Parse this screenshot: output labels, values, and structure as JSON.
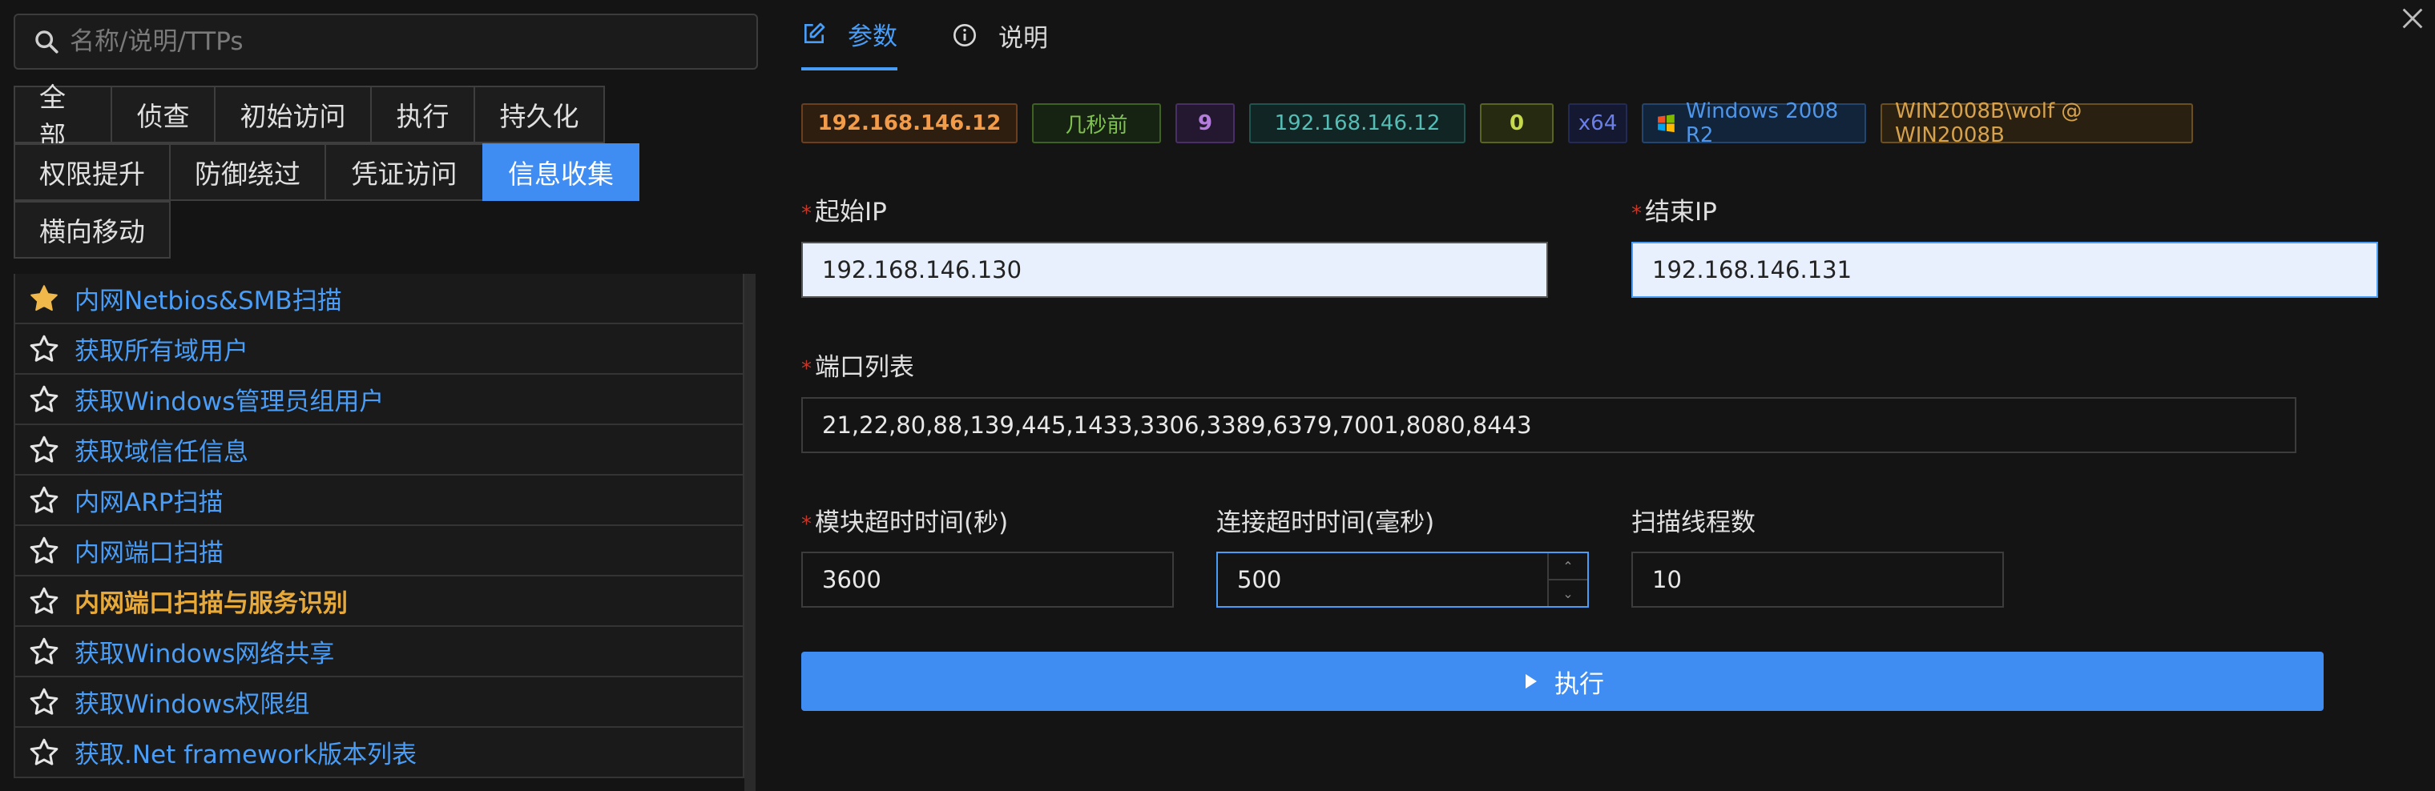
{
  "search": {
    "placeholder": "名称/说明/TTPs",
    "icon": "search-icon"
  },
  "categories": {
    "row1": [
      "全部",
      "侦查",
      "初始访问",
      "执行",
      "持久化"
    ],
    "row2": [
      "权限提升",
      "防御绕过",
      "凭证访问",
      "信息收集"
    ],
    "row3": [
      "横向移动"
    ],
    "active": "信息收集"
  },
  "modules": [
    {
      "label": "内网Netbios&SMB扫描",
      "favorite": true
    },
    {
      "label": "获取所有域用户",
      "favorite": false
    },
    {
      "label": "获取Windows管理员组用户",
      "favorite": false
    },
    {
      "label": "获取域信任信息",
      "favorite": false
    },
    {
      "label": "内网ARP扫描",
      "favorite": false
    },
    {
      "label": "内网端口扫描",
      "favorite": false
    },
    {
      "label": "内网端口扫描与服务识别",
      "favorite": false,
      "selected": true
    },
    {
      "label": "获取Windows网络共享",
      "favorite": false
    },
    {
      "label": "获取Windows权限组",
      "favorite": false
    },
    {
      "label": "获取.Net framework版本列表",
      "favorite": false
    }
  ],
  "tabs": {
    "params": "参数",
    "description": "说明"
  },
  "session": {
    "ip": "192.168.146.12",
    "last_seen": "几秒前",
    "pid": "9",
    "internal_ip": "192.168.146.12",
    "zero": "0",
    "arch": "x64",
    "os": "Windows 2008 R2",
    "user": "WIN2008B\\wolf @ WIN2008B"
  },
  "form": {
    "start_ip": {
      "label": "起始IP",
      "value": "192.168.146.130"
    },
    "end_ip": {
      "label": "结束IP",
      "value": "192.168.146.131"
    },
    "ports": {
      "label": "端口列表",
      "value": "21,22,80,88,139,445,1433,3306,3389,6379,7001,8080,8443"
    },
    "module_timeout": {
      "label": "模块超时时间(秒)",
      "value": "3600"
    },
    "connect_timeout": {
      "label": "连接超时时间(毫秒)",
      "value": "500"
    },
    "threads": {
      "label": "扫描线程数",
      "value": "10"
    },
    "required_mark": "*"
  },
  "execute": {
    "label": "执行"
  },
  "colors": {
    "accent": "#3f8cf2",
    "link": "#4a9df6",
    "highlight": "#e6a93a"
  }
}
